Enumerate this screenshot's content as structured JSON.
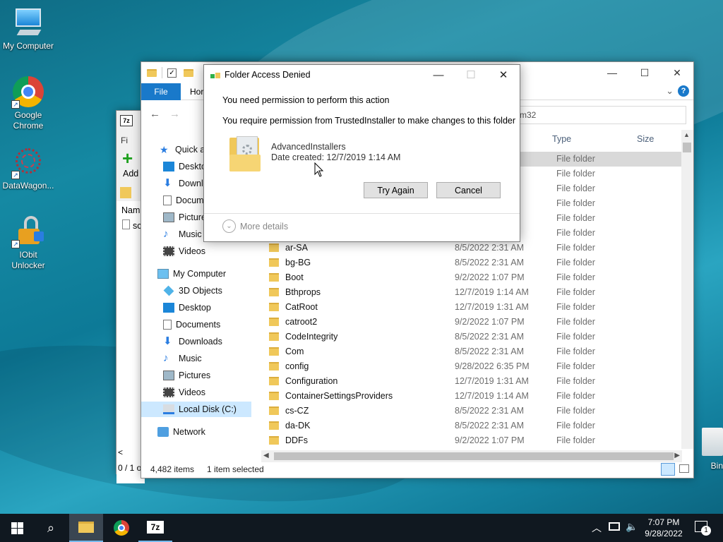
{
  "desktop": {
    "icons": [
      {
        "label": "My Computer"
      },
      {
        "label": "Google Chrome"
      },
      {
        "label": "DataWagon..."
      },
      {
        "label": "IObit Unlocker"
      },
      {
        "label": "Bin"
      }
    ]
  },
  "zip_window": {
    "add_label": "Add",
    "col_name": "Nam",
    "row_text": "sc",
    "status": "0 / 1 o"
  },
  "explorer": {
    "tabs": {
      "file": "File",
      "home": "Hor"
    },
    "address_text": "m32",
    "columns": {
      "type": "Type",
      "size": "Size"
    },
    "nav": [
      {
        "label": "Quick ac"
      },
      {
        "label": "Deskto"
      },
      {
        "label": "Downl"
      },
      {
        "label": "Docum"
      },
      {
        "label": "Picture"
      },
      {
        "label": "Music"
      },
      {
        "label": "Videos"
      },
      {
        "label": "My Computer"
      },
      {
        "label": "3D Objects"
      },
      {
        "label": "Desktop"
      },
      {
        "label": "Documents"
      },
      {
        "label": "Downloads"
      },
      {
        "label": "Music"
      },
      {
        "label": "Pictures"
      },
      {
        "label": "Videos"
      },
      {
        "label": "Local Disk (C:)"
      },
      {
        "label": "Network"
      }
    ],
    "top_types": [
      "File folder",
      "File folder",
      "File folder",
      "File folder",
      "File folder",
      "File folder"
    ],
    "rows": [
      {
        "name": "ar-SA",
        "date": "8/5/2022 2:31 AM",
        "type": "File folder"
      },
      {
        "name": "bg-BG",
        "date": "8/5/2022 2:31 AM",
        "type": "File folder"
      },
      {
        "name": "Boot",
        "date": "9/2/2022 1:07 PM",
        "type": "File folder"
      },
      {
        "name": "Bthprops",
        "date": "12/7/2019 1:14 AM",
        "type": "File folder"
      },
      {
        "name": "CatRoot",
        "date": "12/7/2019 1:31 AM",
        "type": "File folder"
      },
      {
        "name": "catroot2",
        "date": "9/2/2022 1:07 PM",
        "type": "File folder"
      },
      {
        "name": "CodeIntegrity",
        "date": "8/5/2022 2:31 AM",
        "type": "File folder"
      },
      {
        "name": "Com",
        "date": "8/5/2022 2:31 AM",
        "type": "File folder"
      },
      {
        "name": "config",
        "date": "9/28/2022 6:35 PM",
        "type": "File folder"
      },
      {
        "name": "Configuration",
        "date": "12/7/2019 1:31 AM",
        "type": "File folder"
      },
      {
        "name": "ContainerSettingsProviders",
        "date": "12/7/2019 1:14 AM",
        "type": "File folder"
      },
      {
        "name": "cs-CZ",
        "date": "8/5/2022 2:31 AM",
        "type": "File folder"
      },
      {
        "name": "da-DK",
        "date": "8/5/2022 2:31 AM",
        "type": "File folder"
      },
      {
        "name": "DDFs",
        "date": "9/2/2022 1:07 PM",
        "type": "File folder"
      }
    ],
    "status": {
      "items": "4,482 items",
      "selected": "1 item selected"
    }
  },
  "dialog": {
    "title": "Folder Access Denied",
    "heading": "You need permission to perform this action",
    "message": "You require permission from TrustedInstaller to make changes to this folder",
    "folder_name": "AdvancedInstallers",
    "date_created": "Date created: 12/7/2019 1:14 AM",
    "try_again": "Try Again",
    "cancel": "Cancel",
    "more_details": "More details"
  },
  "taskbar": {
    "time": "7:07 PM",
    "date": "9/28/2022",
    "notif_count": "1",
    "zip_label": "7z"
  },
  "colors": {
    "accent": "#1979ca",
    "taskbar": "#101820",
    "selection": "#cce8ff"
  }
}
